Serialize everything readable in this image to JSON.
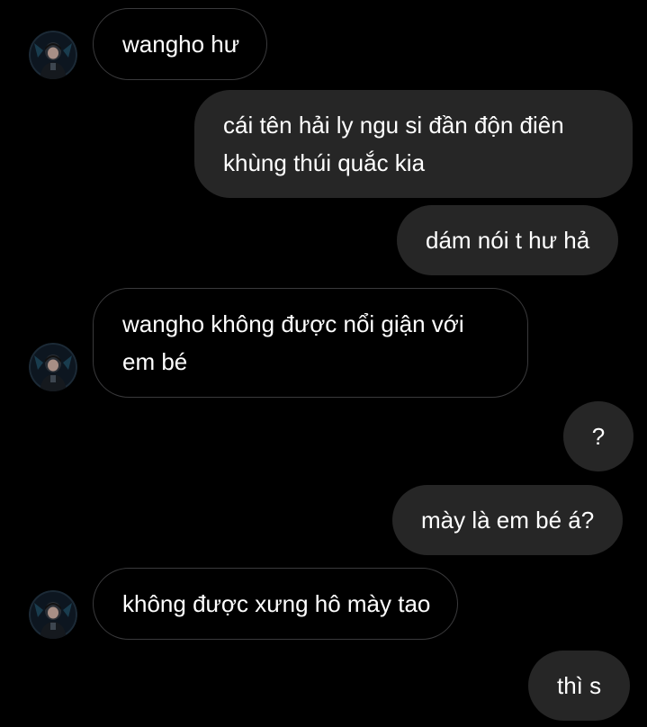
{
  "conversation": {
    "messages": [
      {
        "sender": "other",
        "text": "wangho hư"
      },
      {
        "sender": "me",
        "text": "cái tên hải ly ngu si đần độn điên khùng thúi quắc kia"
      },
      {
        "sender": "me",
        "text": "dám nói t hư hả"
      },
      {
        "sender": "other",
        "text": "wangho không được nổi giận với em bé"
      },
      {
        "sender": "me",
        "text": "?"
      },
      {
        "sender": "me",
        "text": "mày là em bé á?"
      },
      {
        "sender": "other",
        "text": "không được xưng hô mày tao"
      },
      {
        "sender": "me",
        "text": "thì s"
      }
    ]
  },
  "avatar": {
    "icon": "profile-photo"
  },
  "colors": {
    "background": "#000000",
    "outgoing_bubble": "#262626",
    "incoming_border": "#3a3a3c",
    "text": "#ffffff"
  }
}
